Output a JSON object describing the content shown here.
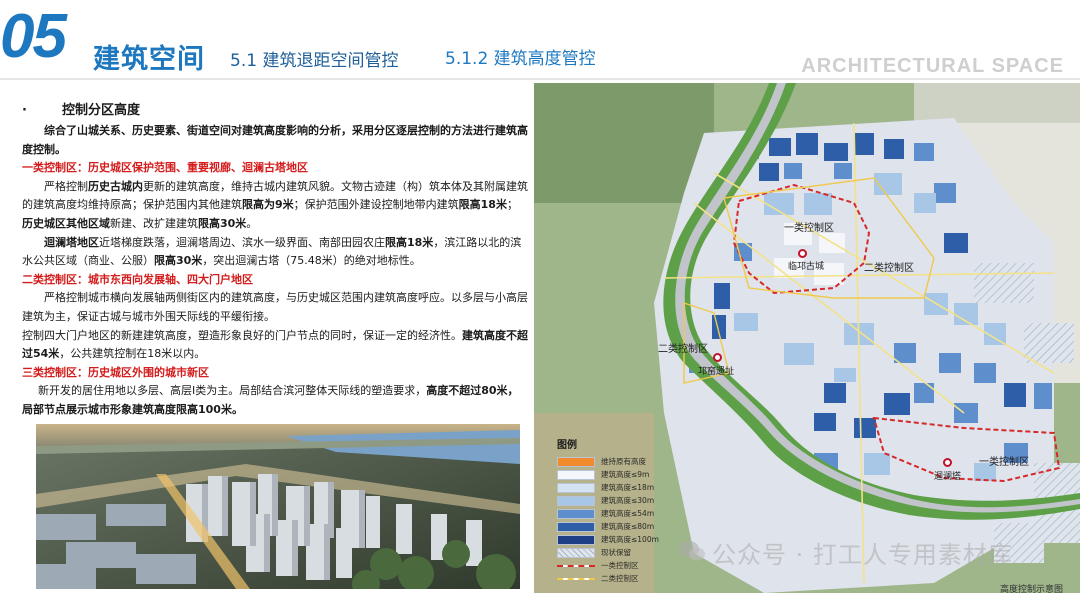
{
  "header": {
    "section_number": "05",
    "section_title": "建筑空间",
    "sub1": "5.1 建筑退距空间管控",
    "sub2": "5.1.2 建筑高度管控",
    "english_title": "ARCHITECTURAL SPACE"
  },
  "text": {
    "heading_bullet": "·",
    "heading": "控制分区高度",
    "intro": "综合了山城关系、历史要素、街道空间对建筑高度影响的分析，采用分区逐层控制的方法进行建筑高度控制。",
    "zone1": {
      "title": "一类控制区：历史城区保护范围、重要视廊、迴澜古塔地区",
      "p1_a": "严格控制",
      "p1_b": "历史古城内",
      "p1_c": "更新的建筑高度，维持古城内建筑风貌。文物古迹建（构）筑本体及其附属建筑的建筑高度均维持原高；保护范围内其他建筑",
      "p1_d": "限高为9米",
      "p1_e": "；保护范围外建设控制地带内建筑",
      "p1_f": "限高18米",
      "p1_g": "；",
      "p1_h": "历史城区其他区域",
      "p1_i": "新建、改扩建建筑",
      "p1_j": "限高30米",
      "p1_k": "。",
      "p2_a": "迴澜塔地区",
      "p2_b": "近塔梯度跌落，迴澜塔周边、滨水一级界面、南部田园农庄",
      "p2_c": "限高18米",
      "p2_d": "，滨江路以北的滨水公共区域（商业、公服）",
      "p2_e": "限高30米",
      "p2_f": "，突出迴澜古塔（75.48米）的绝对地标性。"
    },
    "zone2": {
      "title": "二类控制区：城市东西向发展轴、四大门户地区",
      "p1": "严格控制城市横向发展轴两侧街区内的建筑高度，与历史城区范围内建筑高度呼应。以多层与小高层建筑为主，保证古城与城市外围天际线的平缓衔接。",
      "p2_a": "控制四大门户地区的新建建筑高度，塑造形象良好的门户节点的同时，保证一定的经济性。",
      "p2_b": "建筑高度不超过54米",
      "p2_c": "，公共建筑控制在18米以内。"
    },
    "zone3": {
      "title": "三类控制区：历史城区外围的城市新区",
      "p1_a": "新开发的居住用地以多层、高层Ⅰ类为主。局部结合滨河整体天际线的塑造要求，",
      "p1_b": "高度不超过80米，局部节点展示城市形象建筑高度限高100米。"
    }
  },
  "map": {
    "labels": {
      "zone1_a": "一类控制区",
      "zone2_a": "二类控制区",
      "zone2_b": "二类控制区",
      "zone1_b": "一类控制区",
      "city1": "临邛古城",
      "city2": "邛窑遗址",
      "city3": "迴澜塔"
    },
    "legend": {
      "title": "图例",
      "items": [
        {
          "label": "维持原有高度",
          "color": "#f08a2c"
        },
        {
          "label": "建筑高度≤9m",
          "color": "#f5f6fa"
        },
        {
          "label": "建筑高度≤18m",
          "color": "#d4e2f2"
        },
        {
          "label": "建筑高度≤30m",
          "color": "#a8c6e6"
        },
        {
          "label": "建筑高度≤54m",
          "color": "#5e8fcc"
        },
        {
          "label": "建筑高度≤80m",
          "color": "#2e5ea8"
        },
        {
          "label": "建筑高度≤100m",
          "color": "#1c3f86"
        },
        {
          "label": "现状保留",
          "color": "#c8ccd4"
        },
        {
          "label": "一类控制区",
          "color": "#d62a2a"
        },
        {
          "label": "二类控制区",
          "color": "#f0c94c"
        }
      ]
    },
    "caption": "高度控制示意图"
  },
  "watermark": "公众号 · 打工人专用素材库"
}
